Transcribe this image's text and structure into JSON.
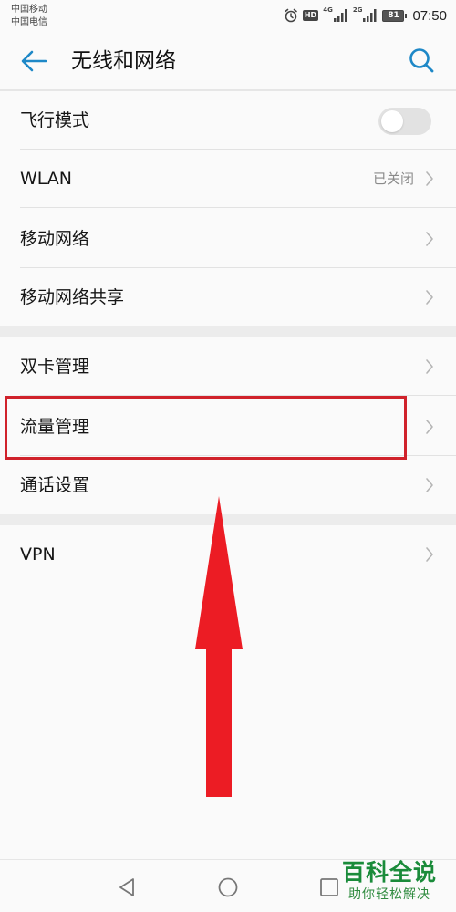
{
  "status_bar": {
    "carrier_1": "中国移动",
    "carrier_2": "中国电信",
    "hd": "HD",
    "net_1": "4G",
    "net_2": "2G",
    "battery": "81",
    "time": "07:50",
    "icons": [
      "alarm-icon",
      "signal-icon",
      "battery-icon"
    ]
  },
  "header": {
    "title": "无线和网络",
    "back_icon": "back-arrow-icon",
    "search_icon": "search-icon",
    "accent_color": "#1e88c7"
  },
  "settings": {
    "airplane_mode": {
      "label": "飞行模式",
      "toggle_on": false
    },
    "wlan": {
      "label": "WLAN",
      "value": "已关闭"
    },
    "mobile_network": {
      "label": "移动网络"
    },
    "tethering": {
      "label": "移动网络共享"
    },
    "dual_sim": {
      "label": "双卡管理"
    },
    "data_usage": {
      "label": "流量管理"
    },
    "call_settings": {
      "label": "通话设置"
    },
    "vpn": {
      "label": "VPN"
    }
  },
  "annotation": {
    "highlight_color": "#d0222b",
    "arrow_color": "#ec1c24"
  },
  "nav_bar": {
    "icons": [
      "back-triangle-icon",
      "home-circle-icon",
      "recents-square-icon"
    ]
  },
  "watermark": {
    "title": "百科全说",
    "subtitle": "助你轻松解决",
    "color": "#1a8b3a"
  }
}
